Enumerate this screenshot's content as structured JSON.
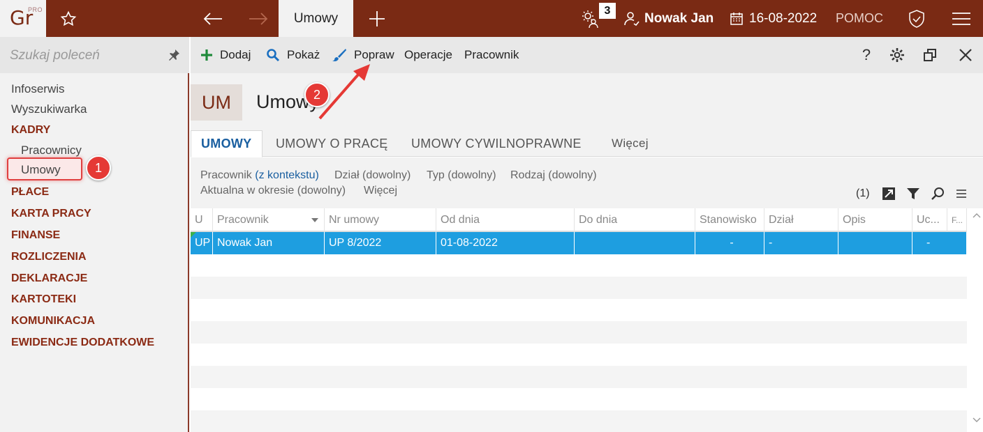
{
  "app": {
    "logo_text": "Gr",
    "logo_sup": "PRO",
    "active_tab": "Umowy",
    "notifications_count": "3",
    "user": "Nowak Jan",
    "date": "16-08-2022",
    "help": "POMOC"
  },
  "sidebar": {
    "search_placeholder": "Szukaj poleceń",
    "items": [
      {
        "label": "Infoserwis"
      },
      {
        "label": "Wyszukiwarka"
      },
      {
        "label": "KADRY"
      },
      {
        "label": "Pracownicy"
      },
      {
        "label": "Umowy"
      },
      {
        "label": "PŁACE"
      },
      {
        "label": "KARTA PRACY"
      },
      {
        "label": "FINANSE"
      },
      {
        "label": "ROZLICZENIA"
      },
      {
        "label": "DEKLARACJE"
      },
      {
        "label": "KARTOTEKI"
      },
      {
        "label": "KOMUNIKACJA"
      },
      {
        "label": "EWIDENCJE DODATKOWE"
      }
    ]
  },
  "toolbar": {
    "add": "Dodaj",
    "show": "Pokaż",
    "edit": "Popraw",
    "operations": "Operacje",
    "employee": "Pracownik",
    "help": "?"
  },
  "header": {
    "code": "UM",
    "title": "Umowy"
  },
  "tabs": [
    {
      "label": "UMOWY"
    },
    {
      "label": "UMOWY O PRACĘ"
    },
    {
      "label": "UMOWY CYWILNOPRAWNE"
    },
    {
      "label": "Więcej"
    }
  ],
  "filters": {
    "employee": "Pracownik",
    "employee_ctx": "(z kontekstu)",
    "department": "Dział (dowolny)",
    "type": "Typ (dowolny)",
    "kind": "Rodzaj (dowolny)",
    "period": "Aktualna w okresie (dowolny)",
    "more": "Więcej",
    "count": "(1)"
  },
  "grid": {
    "columns": [
      "U",
      "Pracownik",
      "Nr umowy",
      "Od dnia",
      "Do dnia",
      "Stanowisko",
      "Dział",
      "Opis",
      "Uc...",
      "F..."
    ],
    "rows": [
      {
        "u": "UP",
        "employee": "Nowak Jan",
        "number": "UP 8/2022",
        "from": "01-08-2022",
        "to": "",
        "position": "-",
        "department": "-",
        "description": "",
        "uc": "-"
      }
    ]
  },
  "markers": {
    "one": "1",
    "two": "2"
  },
  "colors": {
    "brand": "#7a2a14",
    "accent": "#1a5fa0",
    "selection": "#1e9ee0",
    "marker": "#e53935"
  }
}
